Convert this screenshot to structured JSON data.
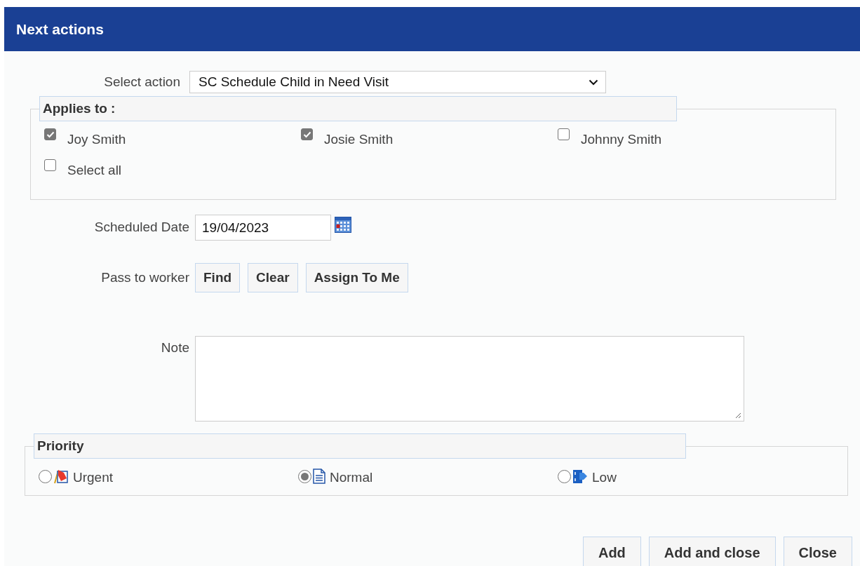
{
  "window": {
    "title": "Next actions"
  },
  "select_action": {
    "label": "Select action",
    "value": "SC Schedule Child in Need Visit"
  },
  "applies_to": {
    "legend": "Applies to :",
    "people": [
      {
        "label": "Joy Smith",
        "checked": true
      },
      {
        "label": "Josie Smith",
        "checked": true
      },
      {
        "label": "Johnny Smith",
        "checked": false
      },
      {
        "label": "Select all",
        "checked": false
      }
    ]
  },
  "scheduled_date": {
    "label": "Scheduled Date",
    "value": "19/04/2023"
  },
  "pass_to_worker": {
    "label": "Pass to worker",
    "buttons": [
      "Find",
      "Clear",
      "Assign To Me"
    ]
  },
  "note": {
    "label": "Note"
  },
  "priority": {
    "legend": "Priority",
    "options": [
      {
        "label": "Urgent",
        "kind": "urgent",
        "selected": false
      },
      {
        "label": "Normal",
        "kind": "normal",
        "selected": true
      },
      {
        "label": "Low",
        "kind": "low",
        "selected": false
      }
    ]
  },
  "buttons": [
    "Add",
    "Add and close",
    "Close"
  ]
}
